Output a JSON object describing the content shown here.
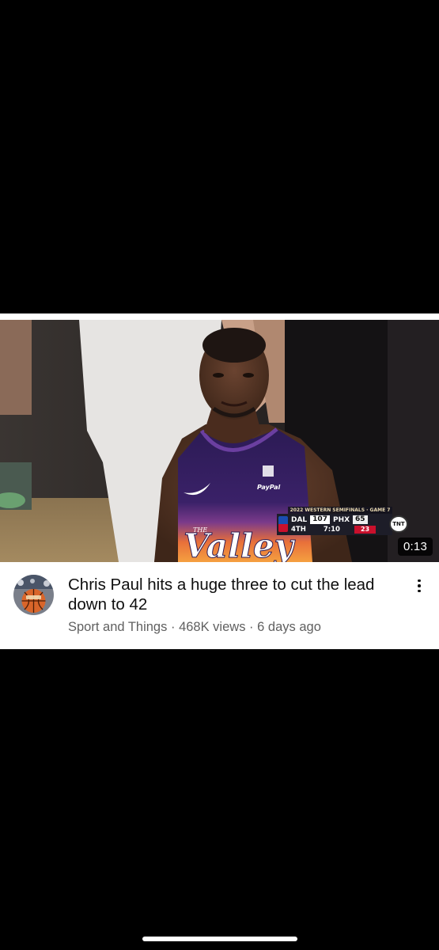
{
  "video": {
    "title": "Chris Paul hits a huge three to cut the lead down to 42",
    "duration": "0:13",
    "channel": "Sport and Things",
    "views": "468K views",
    "separator": "·",
    "age": "6 days ago",
    "menu_icon": "more-vert-icon"
  },
  "scorebug": {
    "header": "2022 WESTERN SEMIFINALS · GAME 7",
    "team1": "DAL",
    "score1": "107",
    "team2": "PHX",
    "score2": "65",
    "period": "4TH",
    "clock": "7:10",
    "bonus": "23",
    "network": "TNT"
  },
  "jersey": {
    "sponsor": "PayPal",
    "wordmark": "Valley",
    "wordmark_small": "THE"
  },
  "colors": {
    "card_bg": "#ffffff",
    "title": "#0f0f0f",
    "meta": "#606060",
    "jersey_purple": "#2c1b55",
    "jersey_orange": "#e8703a"
  }
}
